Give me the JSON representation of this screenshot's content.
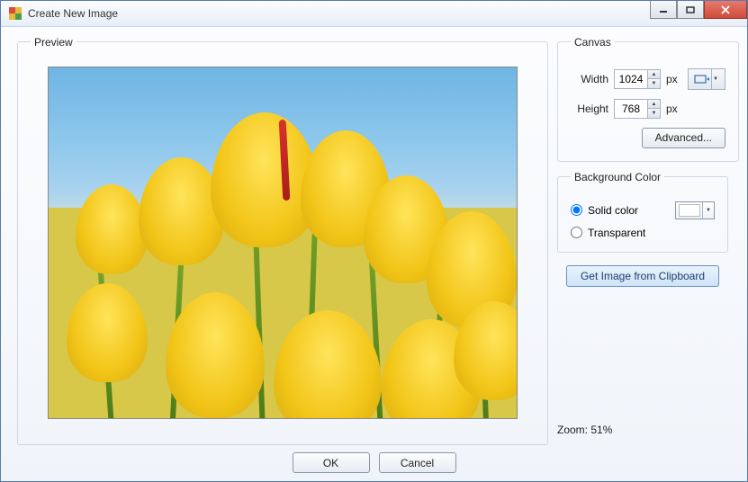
{
  "window": {
    "title": "Create New Image"
  },
  "preview": {
    "legend": "Preview"
  },
  "canvas": {
    "legend": "Canvas",
    "width_label": "Width",
    "width_value": "1024",
    "height_label": "Height",
    "height_value": "768",
    "unit": "px",
    "advanced_label": "Advanced..."
  },
  "background": {
    "legend": "Background Color",
    "solid_label": "Solid color",
    "transparent_label": "Transparent",
    "solid_selected": true,
    "color": "#ffffff"
  },
  "clipboard": {
    "button_label": "Get Image from Clipboard"
  },
  "zoom": {
    "label": "Zoom: 51%"
  },
  "footer": {
    "ok": "OK",
    "cancel": "Cancel"
  }
}
